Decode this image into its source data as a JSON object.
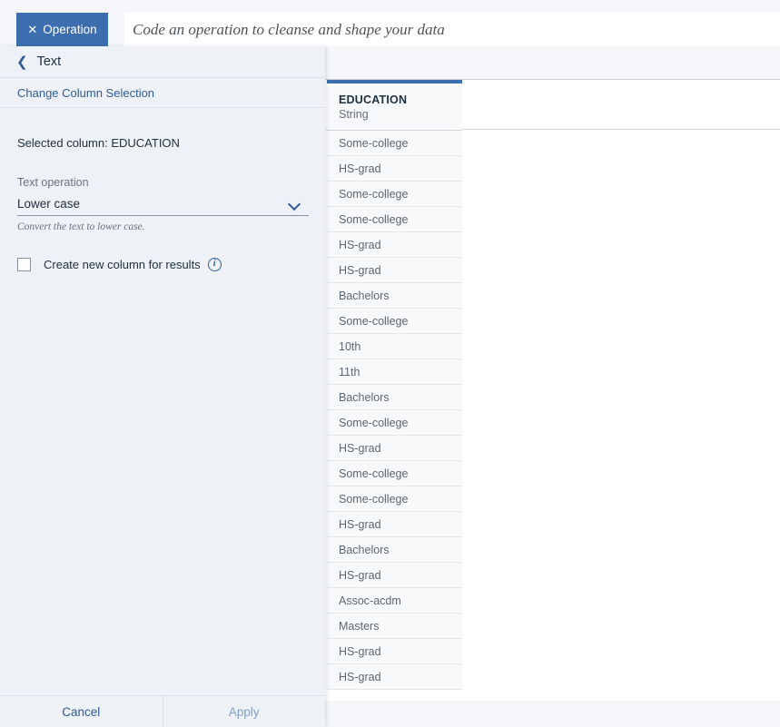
{
  "topbar": {
    "operation_tab_label": "Operation",
    "close_icon": "close-icon",
    "code_placeholder": "Code an operation to cleanse and shape your data",
    "code_value": ""
  },
  "panel": {
    "back_icon": "chevron-left-icon",
    "title": "Text",
    "change_column_link": "Change Column Selection",
    "selected_column_text": "Selected column: EDUCATION",
    "operation_field_label": "Text operation",
    "operation_selected": "Lower case",
    "operation_chevron_icon": "chevron-down-icon",
    "operation_helper": "Convert the text to lower case.",
    "create_column_label": "Create new column for results",
    "create_column_checked": false,
    "info_icon": "info-icon",
    "info_glyph": "i",
    "footer": {
      "cancel_label": "Cancel",
      "apply_label": "Apply"
    }
  },
  "table": {
    "column": {
      "name": "EDUCATION",
      "type": "String",
      "accent_color": "#3d6fb0"
    },
    "rows": [
      "Some-college",
      "HS-grad",
      "Some-college",
      "Some-college",
      "HS-grad",
      "HS-grad",
      "Bachelors",
      "Some-college",
      "10th",
      "11th",
      "Bachelors",
      "Some-college",
      "HS-grad",
      "Some-college",
      "Some-college",
      "HS-grad",
      "Bachelors",
      "HS-grad",
      "Assoc-acdm",
      "Masters",
      "HS-grad",
      "HS-grad"
    ]
  }
}
